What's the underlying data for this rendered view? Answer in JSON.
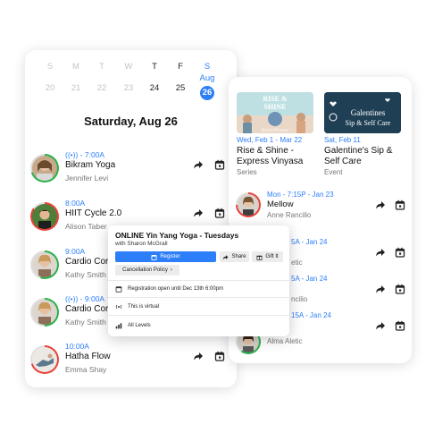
{
  "calendar": {
    "days": [
      {
        "name": "S",
        "num": "20",
        "state": "past"
      },
      {
        "name": "M",
        "num": "21",
        "state": "past"
      },
      {
        "name": "T",
        "num": "22",
        "state": "past"
      },
      {
        "name": "W",
        "num": "23",
        "state": "past"
      },
      {
        "name": "T",
        "num": "24",
        "state": "now"
      },
      {
        "name": "F",
        "num": "25",
        "state": "now"
      },
      {
        "name": "S",
        "month": "Aug",
        "num": "26",
        "state": "selected"
      }
    ],
    "heading": "Saturday, Aug 26"
  },
  "schedule": [
    {
      "time": "7:00A",
      "live": true,
      "name": "Bikram Yoga",
      "instructor": "Jennifer Levi",
      "ring": "#2bb24c"
    },
    {
      "time": "8:00A",
      "live": false,
      "name": "HIIT Cycle 2.0",
      "instructor": "Alison Taber",
      "ring": "#e8433b"
    },
    {
      "time": "9:00A",
      "live": false,
      "name": "Cardio Core",
      "instructor": "Kathy Smith",
      "ring": "#2bb24c"
    },
    {
      "time": "9:00A",
      "live": true,
      "name": "Cardio Core",
      "instructor": "Kathy Smith",
      "ring": "#2bb24c"
    },
    {
      "time": "10:00A",
      "live": false,
      "name": "Hatha Flow",
      "instructor": "Emma Shay",
      "ring": "#e8433b"
    }
  ],
  "events": [
    {
      "date": "Wed, Feb 1 - Mar 22",
      "title": "Rise & Shine - Express Vinyasa",
      "type": "Series",
      "banner_text": [
        "RISE &",
        "SHINE"
      ],
      "banner_script": "Wild Flower"
    },
    {
      "date": "Sat, Feb 11",
      "title": "Galentine's Sip & Self Care",
      "type": "Event",
      "banner_text": [
        "Galentines",
        "Sip & Self Care"
      ]
    }
  ],
  "right_schedule": [
    {
      "time": "Mon - 7:15P - Jan 23",
      "name": "Mellow",
      "instructor": "Anne Rancilio",
      "ring": "#e8433b"
    },
    {
      "time": "5A - Jan 24",
      "name": "",
      "instructor": "etic",
      "ring": "#2bb24c"
    },
    {
      "time": "5A - Jan 24",
      "name": "",
      "instructor": "ncilio",
      "ring": "#2bb24c"
    },
    {
      "time": "15A - Jan 24",
      "name": "",
      "instructor": "",
      "ring": "#2bb24c"
    },
    {
      "time": "",
      "name": "",
      "instructor": "Alma Aletic",
      "ring": "#2bb24c"
    }
  ],
  "popup": {
    "title": "ONLINE Yin Yang Yoga - Tuesdays",
    "subtitle": "with Sharon McGrall",
    "register_label": "Register",
    "share_label": "Share",
    "gift_label": "Gift It",
    "cancellation_label": "Cancellation Policy",
    "registration_text": "Registration open until Dec 13th 6:00pm",
    "virtual_text": "This is virtual",
    "levels_text": "All Levels"
  },
  "colors": {
    "accent": "#2d7ff9",
    "ring_green": "#2bb24c",
    "ring_red": "#e8433b"
  }
}
